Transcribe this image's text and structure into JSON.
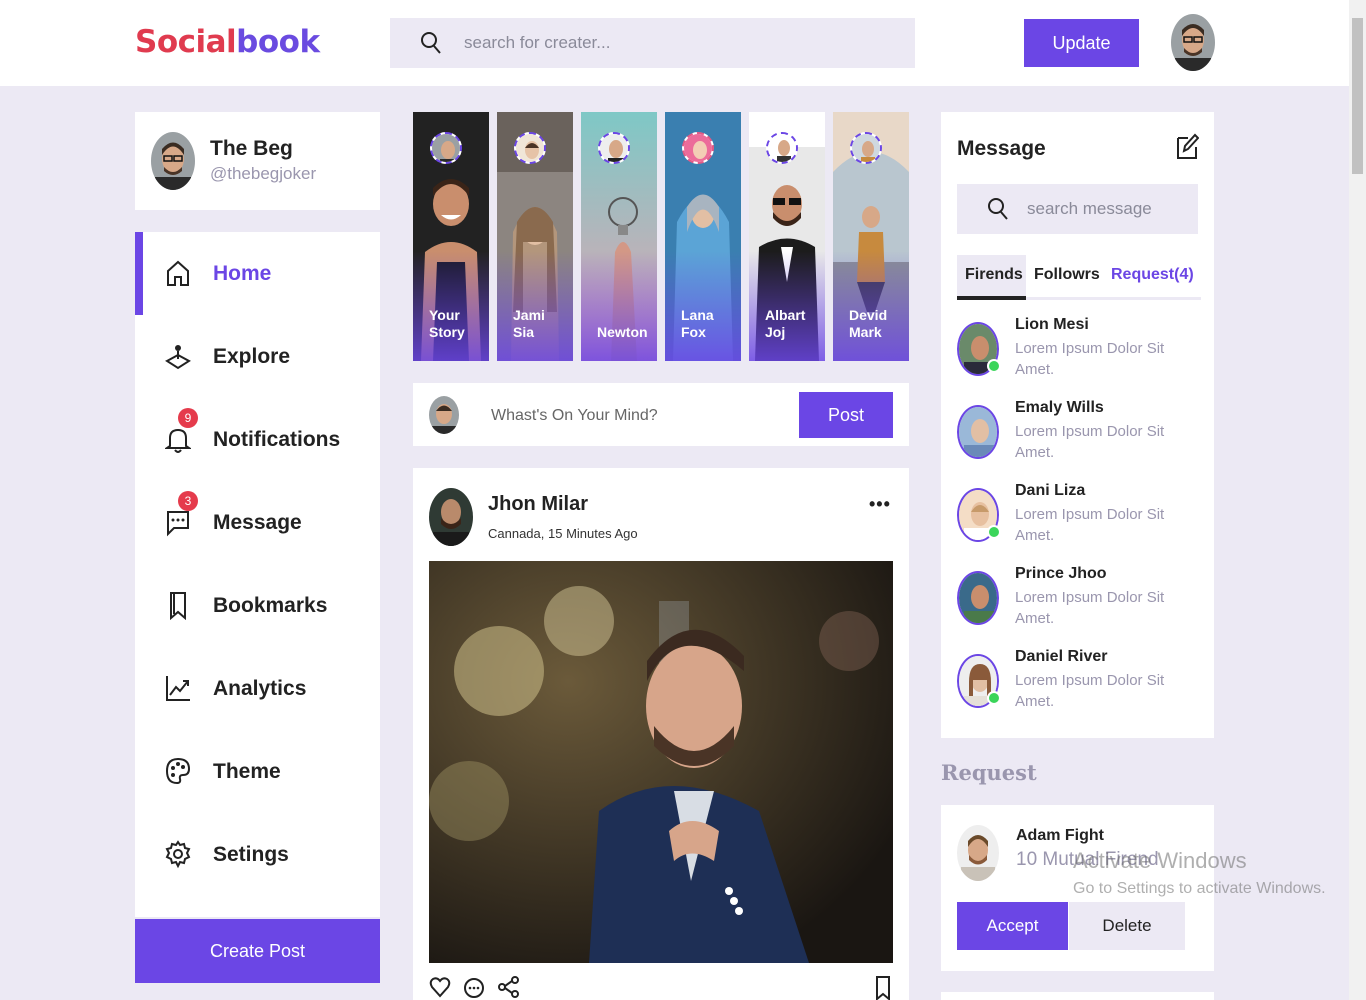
{
  "header": {
    "logo_part1": "Social",
    "logo_part2": "book",
    "search_placeholder": "search for creater...",
    "update_label": "Update"
  },
  "profile": {
    "name": "The Beg",
    "handle": "@thebegjoker"
  },
  "sidebar": {
    "items": [
      {
        "label": "Home",
        "icon": "home-icon",
        "active": true
      },
      {
        "label": "Explore",
        "icon": "explore-icon"
      },
      {
        "label": "Notifications",
        "icon": "bell-icon",
        "badge": "9"
      },
      {
        "label": "Message",
        "icon": "chat-icon",
        "badge": "3"
      },
      {
        "label": "Bookmarks",
        "icon": "bookmark-icon"
      },
      {
        "label": "Analytics",
        "icon": "analytics-icon"
      },
      {
        "label": "Theme",
        "icon": "palette-icon"
      },
      {
        "label": "Setings",
        "icon": "gear-icon"
      }
    ],
    "create_label": "Create Post"
  },
  "stories": [
    {
      "line1": "Your",
      "line2": "Story"
    },
    {
      "line1": "Jami",
      "line2": "Sia"
    },
    {
      "line1": "",
      "line2": "Newton"
    },
    {
      "line1": "Lana",
      "line2": "Fox"
    },
    {
      "line1": "Albart",
      "line2": "Joj"
    },
    {
      "line1": "Devid",
      "line2": "Mark"
    }
  ],
  "composer": {
    "placeholder": "Whast's On Your Mind?",
    "post_label": "Post"
  },
  "feed": {
    "author": "Jhon Milar",
    "meta": "Cannada, 15 Minutes Ago",
    "more": "•••"
  },
  "messages": {
    "title": "Message",
    "search_placeholder": "search message",
    "tabs": [
      "Firends",
      "Followrs",
      "Request(4)"
    ],
    "contacts": [
      {
        "name": "Lion Mesi",
        "text": "Lorem Ipsum Dolor Sit Amet."
      },
      {
        "name": "Emaly Wills",
        "text": "Lorem Ipsum Dolor Sit Amet."
      },
      {
        "name": "Dani Liza",
        "text": "Lorem Ipsum Dolor Sit Amet."
      },
      {
        "name": "Prince Jhoo",
        "text": "Lorem Ipsum Dolor Sit Amet."
      },
      {
        "name": "Daniel River",
        "text": "Lorem Ipsum Dolor Sit Amet."
      }
    ]
  },
  "request": {
    "title": "Request",
    "name": "Adam Fight",
    "mutual": "10 Mutual Firend",
    "accept_label": "Accept",
    "delete_label": "Delete"
  },
  "watermark": {
    "line1": "Activate Windows",
    "line2": "Go to Settings to activate Windows."
  },
  "colors": {
    "accent": "#6b46e5",
    "logo_red": "#e03b4f",
    "online": "#3bd55a",
    "badge": "#e53b4c",
    "background": "#ece9f4"
  }
}
